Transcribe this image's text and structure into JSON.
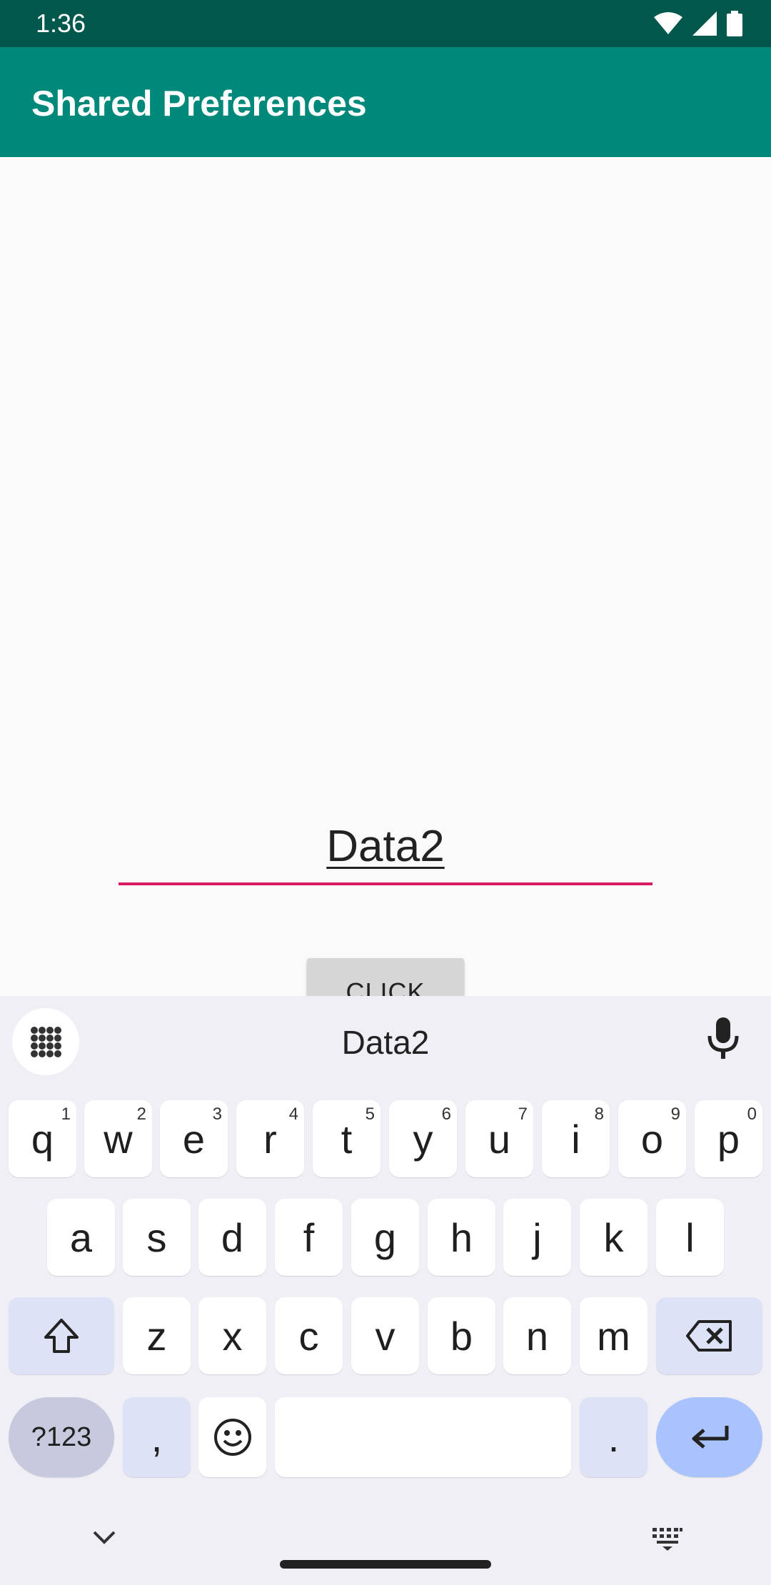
{
  "status_bar": {
    "time": "1:36"
  },
  "app_bar": {
    "title": "Shared Preferences"
  },
  "edit_text": {
    "value": "Data2"
  },
  "button": {
    "label": "CLICK"
  },
  "keyboard": {
    "suggestion": "Data2",
    "row1": [
      {
        "k": "q",
        "h": "1"
      },
      {
        "k": "w",
        "h": "2"
      },
      {
        "k": "e",
        "h": "3"
      },
      {
        "k": "r",
        "h": "4"
      },
      {
        "k": "t",
        "h": "5"
      },
      {
        "k": "y",
        "h": "6"
      },
      {
        "k": "u",
        "h": "7"
      },
      {
        "k": "i",
        "h": "8"
      },
      {
        "k": "o",
        "h": "9"
      },
      {
        "k": "p",
        "h": "0"
      }
    ],
    "row2": [
      "a",
      "s",
      "d",
      "f",
      "g",
      "h",
      "j",
      "k",
      "l"
    ],
    "row3": [
      "z",
      "x",
      "c",
      "v",
      "b",
      "n",
      "m"
    ],
    "symbols_label": "?123",
    "comma_label": ",",
    "period_label": "."
  },
  "colors": {
    "status_bar": "#00574b",
    "app_bar": "#00897b",
    "accent": "#d81b60",
    "enter_key": "#a9c3ff"
  }
}
